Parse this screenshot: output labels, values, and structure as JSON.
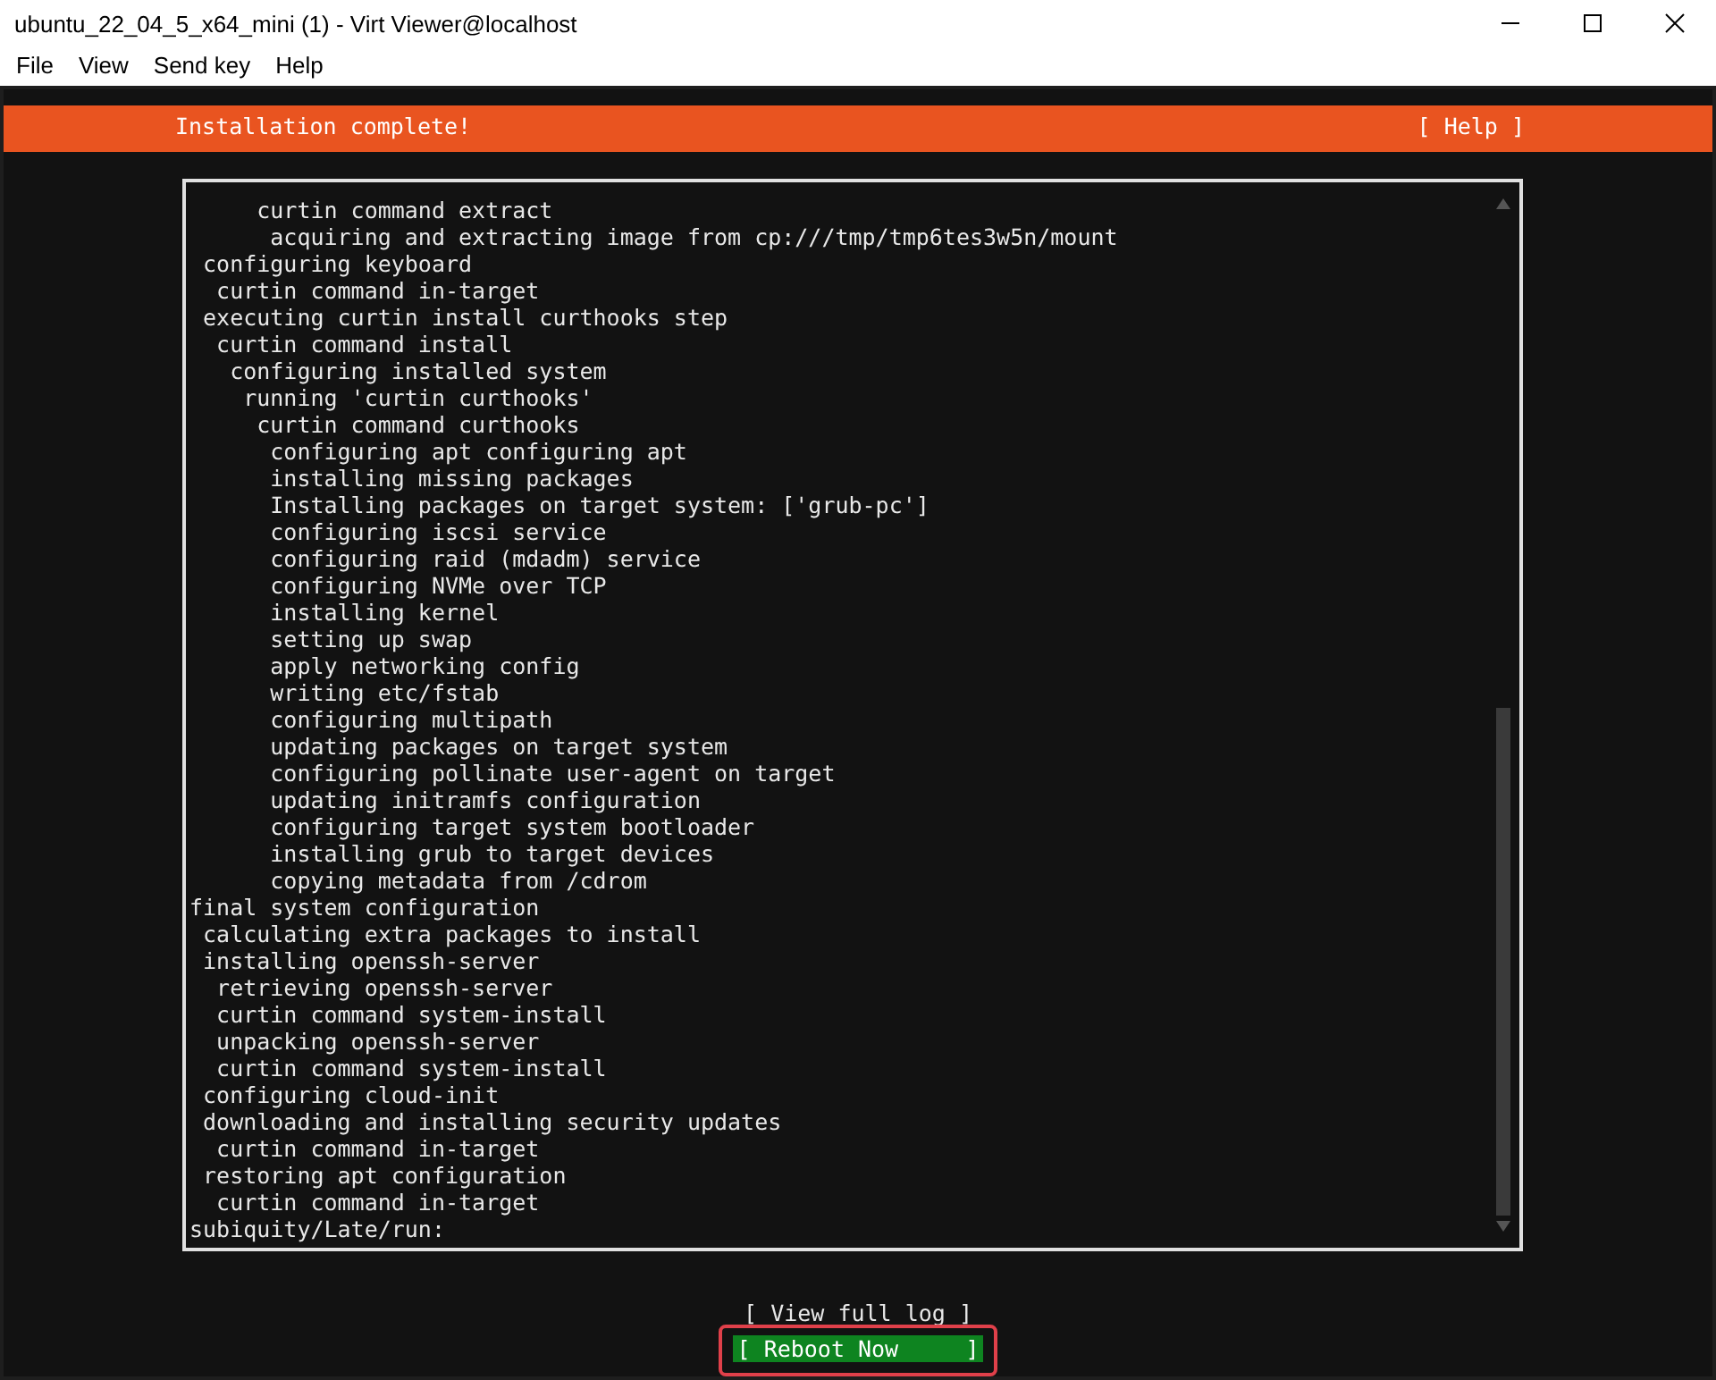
{
  "window": {
    "title": "ubuntu_22_04_5_x64_mini (1) - Virt Viewer@localhost"
  },
  "menu": [
    "File",
    "View",
    "Send key",
    "Help"
  ],
  "header": {
    "title": "Installation complete!",
    "help": "[ Help ]"
  },
  "log": {
    "lines": [
      "     curtin command extract",
      "      acquiring and extracting image from cp:///tmp/tmp6tes3w5n/mount",
      " configuring keyboard",
      "  curtin command in-target",
      " executing curtin install curthooks step",
      "  curtin command install",
      "   configuring installed system",
      "    running 'curtin curthooks'",
      "     curtin command curthooks",
      "      configuring apt configuring apt",
      "      installing missing packages",
      "      Installing packages on target system: ['grub-pc']",
      "      configuring iscsi service",
      "      configuring raid (mdadm) service",
      "      configuring NVMe over TCP",
      "      installing kernel",
      "      setting up swap",
      "      apply networking config",
      "      writing etc/fstab",
      "      configuring multipath",
      "      updating packages on target system",
      "      configuring pollinate user-agent on target",
      "      updating initramfs configuration",
      "      configuring target system bootloader",
      "      installing grub to target devices",
      "      copying metadata from /cdrom",
      "final system configuration",
      " calculating extra packages to install",
      " installing openssh-server",
      "  retrieving openssh-server",
      "  curtin command system-install",
      "  unpacking openssh-server",
      "  curtin command system-install",
      " configuring cloud-init",
      " downloading and installing security updates",
      "  curtin command in-target",
      " restoring apt configuration",
      "  curtin command in-target",
      "subiquity/Late/run:"
    ]
  },
  "buttons": [
    {
      "label": "[ View full log ]",
      "selected": false,
      "highlighted": false
    },
    {
      "label": "[ Reboot Now     ]",
      "selected": true,
      "highlighted": true
    }
  ]
}
